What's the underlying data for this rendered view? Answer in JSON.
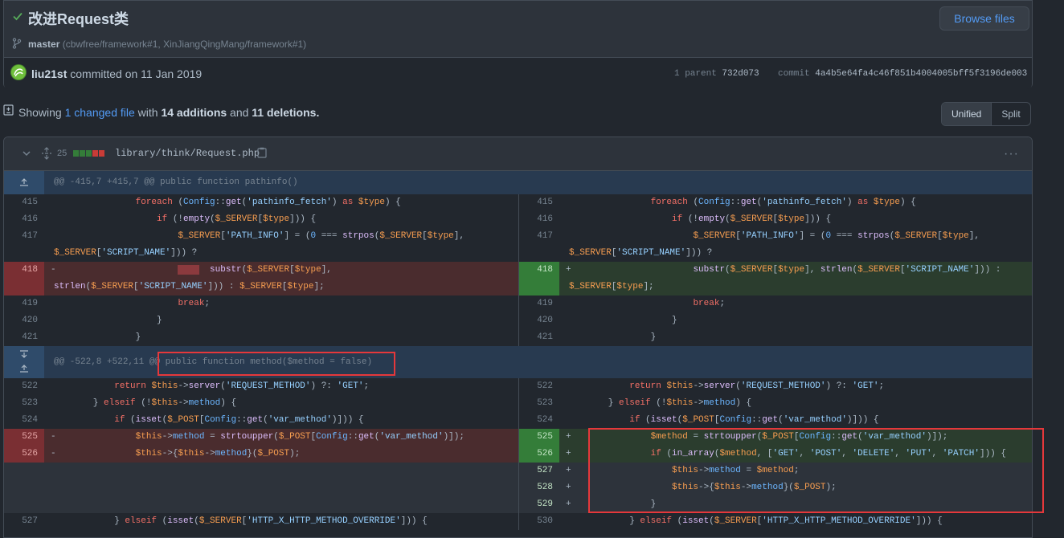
{
  "commit": {
    "title": "改进Request类",
    "branch": "master",
    "branch_refs": "(cbwfree/framework#1, XinJiangQingMang/framework#1)",
    "browse_label": "Browse files",
    "author": "liu21st",
    "committed_text": "committed on 11 Jan 2019",
    "parent_label": "1 parent",
    "parent_sha": "732d073",
    "commit_label": "commit",
    "commit_sha": "4a4b5e64fa4c46f851b4004005bff5f3196de003"
  },
  "toc": {
    "showing": "Showing",
    "changed": "1 changed file",
    "with": "with",
    "additions": "14 additions",
    "and": "and",
    "deletions": "11 deletions."
  },
  "view_toggle": {
    "unified": "Unified",
    "split": "Split"
  },
  "file": {
    "changes": "25",
    "path": "library/think/Request.php",
    "more": "···",
    "stat_colors": [
      "#347d39",
      "#347d39",
      "#347d39",
      "#c93c37",
      "#c93c37"
    ]
  },
  "hunks": [
    {
      "header": "@@ -415,7 +415,7 @@ public function pathinfo()"
    },
    {
      "header": "@@ -522,8 +522,11 @@ public function method($method = false)"
    }
  ],
  "colors": {
    "accent": "#539bf5",
    "addition": "#347d39",
    "deletion": "#c93c37",
    "annotation": "#e5383b"
  }
}
